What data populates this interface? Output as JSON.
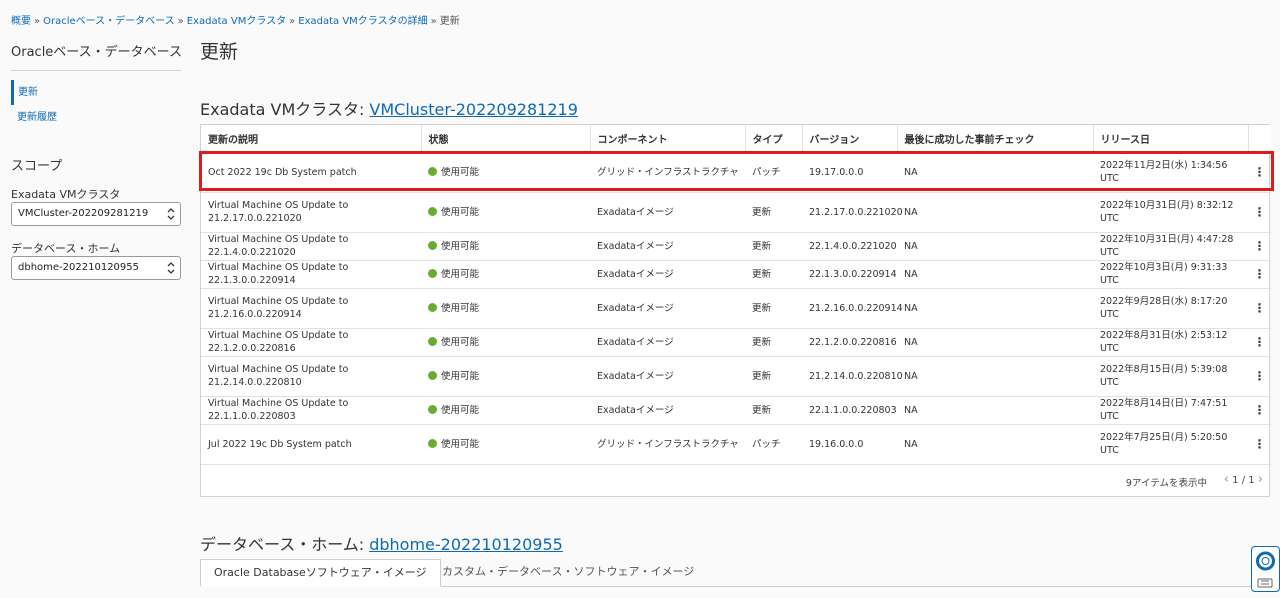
{
  "breadcrumb": {
    "items": [
      "概要",
      "Oracleベース・データベース",
      "Exadata VMクラスタ",
      "Exadata VMクラスタの詳細"
    ],
    "current": "更新",
    "separator": "»"
  },
  "sidebar": {
    "title": "Oracleベース・データベース",
    "nav": [
      {
        "label": "更新"
      },
      {
        "label": "更新履歴"
      }
    ],
    "scope_title": "スコープ",
    "vm_cluster_label": "Exadata VMクラスタ",
    "vm_cluster_value": "VMCluster-202209281219",
    "db_home_label": "データベース・ホーム",
    "db_home_value": "dbhome-202210120955"
  },
  "page_title": "更新",
  "cluster_section": {
    "prefix": "Exadata VMクラスタ: ",
    "link": "VMCluster-202209281219"
  },
  "table": {
    "headers": [
      "更新の説明",
      "状態",
      "コンポーネント",
      "タイプ",
      "バージョン",
      "最後に成功した事前チェック",
      "リリース日"
    ],
    "rows": [
      {
        "desc": "Oct 2022 19c Db System patch",
        "status": "使用可能",
        "component": "グリッド・インフラストラクチャ",
        "type": "パッチ",
        "version": "19.17.0.0.0",
        "precheck": "NA",
        "release": "2022年11月2日(水) 1:34:56 UTC"
      },
      {
        "desc": "Virtual Machine OS Update to 21.2.17.0.0.221020",
        "status": "使用可能",
        "component": "Exadataイメージ",
        "type": "更新",
        "version": "21.2.17.0.0.221020",
        "precheck": "NA",
        "release": "2022年10月31日(月) 8:32:12 UTC"
      },
      {
        "desc": "Virtual Machine OS Update to 22.1.4.0.0.221020",
        "status": "使用可能",
        "component": "Exadataイメージ",
        "type": "更新",
        "version": "22.1.4.0.0.221020",
        "precheck": "NA",
        "release": "2022年10月31日(月) 4:47:28 UTC"
      },
      {
        "desc": "Virtual Machine OS Update to 22.1.3.0.0.220914",
        "status": "使用可能",
        "component": "Exadataイメージ",
        "type": "更新",
        "version": "22.1.3.0.0.220914",
        "precheck": "NA",
        "release": "2022年10月3日(月) 9:31:33 UTC"
      },
      {
        "desc": "Virtual Machine OS Update to 21.2.16.0.0.220914",
        "status": "使用可能",
        "component": "Exadataイメージ",
        "type": "更新",
        "version": "21.2.16.0.0.220914",
        "precheck": "NA",
        "release": "2022年9月28日(水) 8:17:20 UTC"
      },
      {
        "desc": "Virtual Machine OS Update to 22.1.2.0.0.220816",
        "status": "使用可能",
        "component": "Exadataイメージ",
        "type": "更新",
        "version": "22.1.2.0.0.220816",
        "precheck": "NA",
        "release": "2022年8月31日(水) 2:53:12 UTC"
      },
      {
        "desc": "Virtual Machine OS Update to 21.2.14.0.0.220810",
        "status": "使用可能",
        "component": "Exadataイメージ",
        "type": "更新",
        "version": "21.2.14.0.0.220810",
        "precheck": "NA",
        "release": "2022年8月15日(月) 5:39:08 UTC"
      },
      {
        "desc": "Virtual Machine OS Update to 22.1.1.0.0.220803",
        "status": "使用可能",
        "component": "Exadataイメージ",
        "type": "更新",
        "version": "22.1.1.0.0.220803",
        "precheck": "NA",
        "release": "2022年8月14日(日) 7:47:51 UTC"
      },
      {
        "desc": "Jul 2022 19c Db System patch",
        "status": "使用可能",
        "component": "グリッド・インフラストラクチャ",
        "type": "パッチ",
        "version": "19.16.0.0.0",
        "precheck": "NA",
        "release": "2022年7月25日(月) 5:20:50 UTC"
      }
    ],
    "item_count": "9アイテムを表示中",
    "page": "1 / 1"
  },
  "db_home_section": {
    "prefix": "データベース・ホーム: ",
    "link": "dbhome-202210120955"
  },
  "tabs": [
    {
      "label": "Oracle Databaseソフトウェア・イメージ"
    },
    {
      "label": "カスタム・データベース・ソフトウェア・イメージ"
    }
  ],
  "colors": {
    "link": "#0f6ab4",
    "status_available": "#6aaa32",
    "highlight": "#e01b1b"
  },
  "icons": {
    "row_actions": "kebab-menu-icon",
    "help": "lifebuoy-icon"
  }
}
